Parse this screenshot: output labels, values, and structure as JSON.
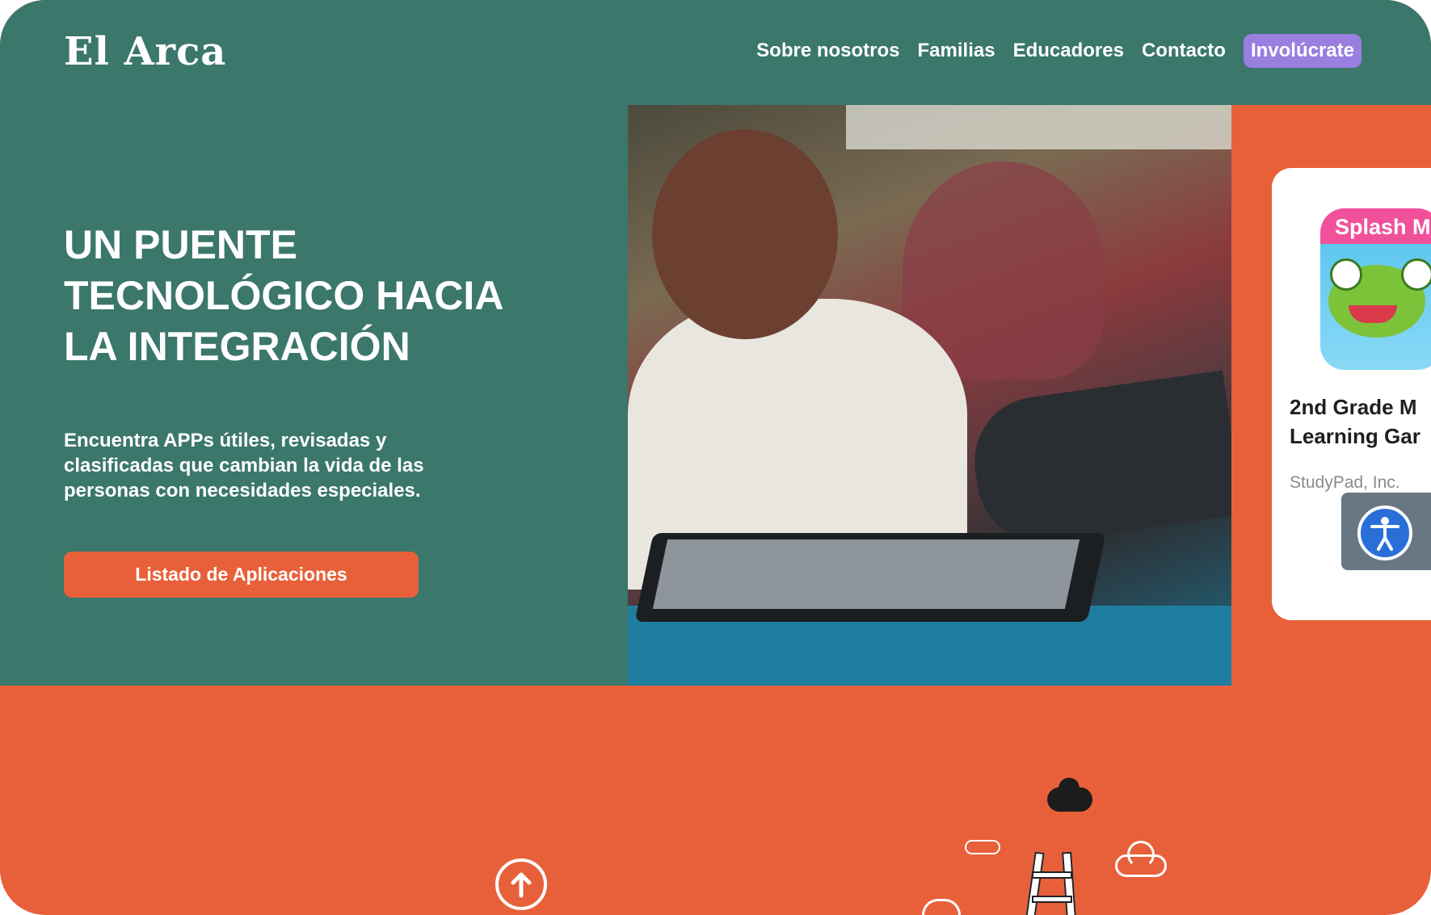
{
  "brand": {
    "logo": "El Arca"
  },
  "nav": {
    "items": [
      "Sobre nosotros",
      "Familias",
      "Educadores",
      "Contacto"
    ],
    "cta": "Involúcrate"
  },
  "hero": {
    "title": "UN PUENTE TECNOLÓGICO HACIA LA INTEGRACIÓN",
    "subtitle": "Encuentra APPs útiles, revisadas y clasificadas que cambian la vida de las personas con necesidades especiales.",
    "button": "Listado de Aplicaciones"
  },
  "app_card": {
    "icon_label": "Splash M",
    "title_line1": "2nd Grade M",
    "title_line2": "Learning Gar",
    "developer": "StudyPad, Inc."
  },
  "colors": {
    "header_green": "#3b776b",
    "accent_orange": "#e8603a",
    "cta_purple": "#9a7ee0",
    "accessibility_blue": "#2a6fd8"
  },
  "icons": {
    "accessibility": "accessibility-person-icon",
    "scroll_up": "arrow-up-circle-icon"
  }
}
